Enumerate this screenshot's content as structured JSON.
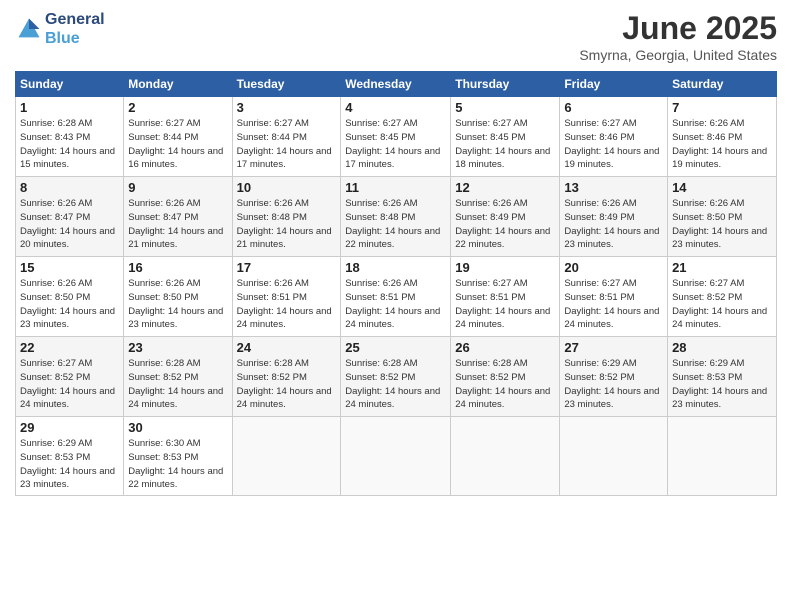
{
  "logo": {
    "line1": "General",
    "line2": "Blue"
  },
  "title": "June 2025",
  "location": "Smyrna, Georgia, United States",
  "days_header": [
    "Sunday",
    "Monday",
    "Tuesday",
    "Wednesday",
    "Thursday",
    "Friday",
    "Saturday"
  ],
  "weeks": [
    [
      {
        "day": "1",
        "sunrise": "Sunrise: 6:28 AM",
        "sunset": "Sunset: 8:43 PM",
        "daylight": "Daylight: 14 hours and 15 minutes."
      },
      {
        "day": "2",
        "sunrise": "Sunrise: 6:27 AM",
        "sunset": "Sunset: 8:44 PM",
        "daylight": "Daylight: 14 hours and 16 minutes."
      },
      {
        "day": "3",
        "sunrise": "Sunrise: 6:27 AM",
        "sunset": "Sunset: 8:44 PM",
        "daylight": "Daylight: 14 hours and 17 minutes."
      },
      {
        "day": "4",
        "sunrise": "Sunrise: 6:27 AM",
        "sunset": "Sunset: 8:45 PM",
        "daylight": "Daylight: 14 hours and 17 minutes."
      },
      {
        "day": "5",
        "sunrise": "Sunrise: 6:27 AM",
        "sunset": "Sunset: 8:45 PM",
        "daylight": "Daylight: 14 hours and 18 minutes."
      },
      {
        "day": "6",
        "sunrise": "Sunrise: 6:27 AM",
        "sunset": "Sunset: 8:46 PM",
        "daylight": "Daylight: 14 hours and 19 minutes."
      },
      {
        "day": "7",
        "sunrise": "Sunrise: 6:26 AM",
        "sunset": "Sunset: 8:46 PM",
        "daylight": "Daylight: 14 hours and 19 minutes."
      }
    ],
    [
      {
        "day": "8",
        "sunrise": "Sunrise: 6:26 AM",
        "sunset": "Sunset: 8:47 PM",
        "daylight": "Daylight: 14 hours and 20 minutes."
      },
      {
        "day": "9",
        "sunrise": "Sunrise: 6:26 AM",
        "sunset": "Sunset: 8:47 PM",
        "daylight": "Daylight: 14 hours and 21 minutes."
      },
      {
        "day": "10",
        "sunrise": "Sunrise: 6:26 AM",
        "sunset": "Sunset: 8:48 PM",
        "daylight": "Daylight: 14 hours and 21 minutes."
      },
      {
        "day": "11",
        "sunrise": "Sunrise: 6:26 AM",
        "sunset": "Sunset: 8:48 PM",
        "daylight": "Daylight: 14 hours and 22 minutes."
      },
      {
        "day": "12",
        "sunrise": "Sunrise: 6:26 AM",
        "sunset": "Sunset: 8:49 PM",
        "daylight": "Daylight: 14 hours and 22 minutes."
      },
      {
        "day": "13",
        "sunrise": "Sunrise: 6:26 AM",
        "sunset": "Sunset: 8:49 PM",
        "daylight": "Daylight: 14 hours and 23 minutes."
      },
      {
        "day": "14",
        "sunrise": "Sunrise: 6:26 AM",
        "sunset": "Sunset: 8:50 PM",
        "daylight": "Daylight: 14 hours and 23 minutes."
      }
    ],
    [
      {
        "day": "15",
        "sunrise": "Sunrise: 6:26 AM",
        "sunset": "Sunset: 8:50 PM",
        "daylight": "Daylight: 14 hours and 23 minutes."
      },
      {
        "day": "16",
        "sunrise": "Sunrise: 6:26 AM",
        "sunset": "Sunset: 8:50 PM",
        "daylight": "Daylight: 14 hours and 23 minutes."
      },
      {
        "day": "17",
        "sunrise": "Sunrise: 6:26 AM",
        "sunset": "Sunset: 8:51 PM",
        "daylight": "Daylight: 14 hours and 24 minutes."
      },
      {
        "day": "18",
        "sunrise": "Sunrise: 6:26 AM",
        "sunset": "Sunset: 8:51 PM",
        "daylight": "Daylight: 14 hours and 24 minutes."
      },
      {
        "day": "19",
        "sunrise": "Sunrise: 6:27 AM",
        "sunset": "Sunset: 8:51 PM",
        "daylight": "Daylight: 14 hours and 24 minutes."
      },
      {
        "day": "20",
        "sunrise": "Sunrise: 6:27 AM",
        "sunset": "Sunset: 8:51 PM",
        "daylight": "Daylight: 14 hours and 24 minutes."
      },
      {
        "day": "21",
        "sunrise": "Sunrise: 6:27 AM",
        "sunset": "Sunset: 8:52 PM",
        "daylight": "Daylight: 14 hours and 24 minutes."
      }
    ],
    [
      {
        "day": "22",
        "sunrise": "Sunrise: 6:27 AM",
        "sunset": "Sunset: 8:52 PM",
        "daylight": "Daylight: 14 hours and 24 minutes."
      },
      {
        "day": "23",
        "sunrise": "Sunrise: 6:28 AM",
        "sunset": "Sunset: 8:52 PM",
        "daylight": "Daylight: 14 hours and 24 minutes."
      },
      {
        "day": "24",
        "sunrise": "Sunrise: 6:28 AM",
        "sunset": "Sunset: 8:52 PM",
        "daylight": "Daylight: 14 hours and 24 minutes."
      },
      {
        "day": "25",
        "sunrise": "Sunrise: 6:28 AM",
        "sunset": "Sunset: 8:52 PM",
        "daylight": "Daylight: 14 hours and 24 minutes."
      },
      {
        "day": "26",
        "sunrise": "Sunrise: 6:28 AM",
        "sunset": "Sunset: 8:52 PM",
        "daylight": "Daylight: 14 hours and 24 minutes."
      },
      {
        "day": "27",
        "sunrise": "Sunrise: 6:29 AM",
        "sunset": "Sunset: 8:52 PM",
        "daylight": "Daylight: 14 hours and 23 minutes."
      },
      {
        "day": "28",
        "sunrise": "Sunrise: 6:29 AM",
        "sunset": "Sunset: 8:53 PM",
        "daylight": "Daylight: 14 hours and 23 minutes."
      }
    ],
    [
      {
        "day": "29",
        "sunrise": "Sunrise: 6:29 AM",
        "sunset": "Sunset: 8:53 PM",
        "daylight": "Daylight: 14 hours and 23 minutes."
      },
      {
        "day": "30",
        "sunrise": "Sunrise: 6:30 AM",
        "sunset": "Sunset: 8:53 PM",
        "daylight": "Daylight: 14 hours and 22 minutes."
      },
      null,
      null,
      null,
      null,
      null
    ]
  ]
}
